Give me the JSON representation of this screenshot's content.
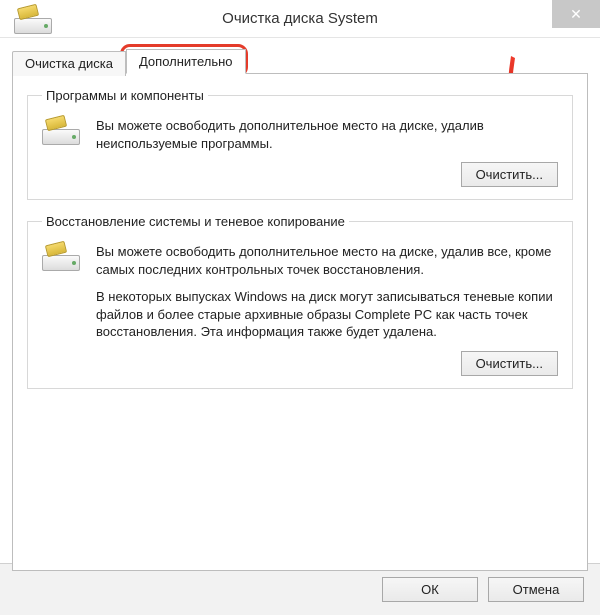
{
  "window": {
    "title": "Очистка диска System",
    "close": "✕"
  },
  "tabs": {
    "cleanup": "Очистка диска",
    "more": "Дополнительно"
  },
  "groups": {
    "programs": {
      "legend": "Программы и компоненты",
      "text": "Вы можете освободить дополнительное место на диске, удалив неиспользуемые программы.",
      "button": "Очистить..."
    },
    "restore": {
      "legend": "Восстановление системы и теневое копирование",
      "text1": "Вы можете освободить дополнительное место на диске, удалив все, кроме самых последних контрольных точек восстановления.",
      "text2": "В некоторых выпусках Windows на диск могут записываться теневые копии файлов и более старые архивные образы Complete PC как часть точек восстановления. Эта информация также будет удалена.",
      "button": "Очистить..."
    }
  },
  "footer": {
    "ok": "ОК",
    "cancel": "Отмена"
  }
}
